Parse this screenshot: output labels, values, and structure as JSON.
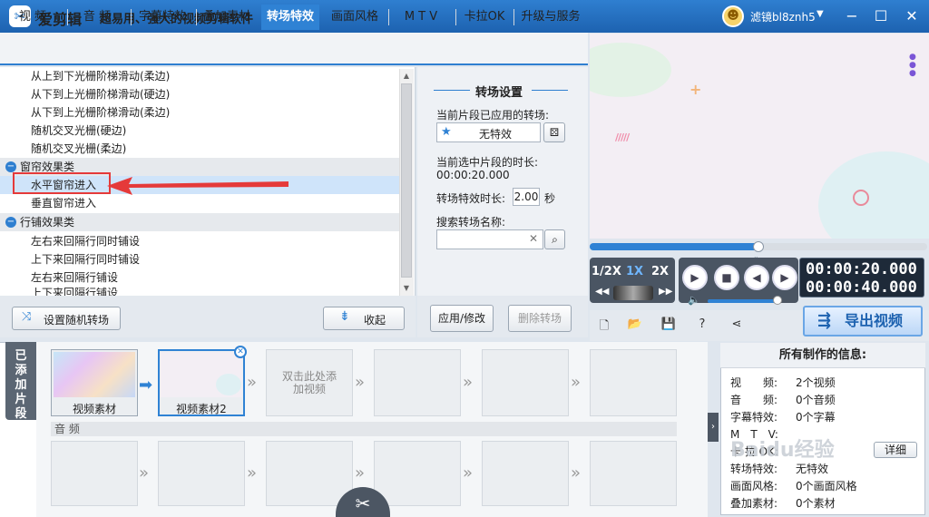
{
  "app": {
    "name": "爱剪辑",
    "slogan": "超易用、强大的视频剪辑软件",
    "username": "滤镜bl8znh5"
  },
  "tabs": [
    {
      "label": "视 频"
    },
    {
      "label": "音 频"
    },
    {
      "label": "字幕特效"
    },
    {
      "label": "叠加素材"
    },
    {
      "label": "转场特效",
      "active": true
    },
    {
      "label": "画面风格"
    },
    {
      "label": "M T V"
    },
    {
      "label": "卡拉OK"
    },
    {
      "label": "升级与服务"
    }
  ],
  "effects": {
    "items_top": [
      "从上到下光栅阶梯滑动(柔边)",
      "从下到上光栅阶梯滑动(硬边)",
      "从下到上光栅阶梯滑动(柔边)",
      "随机交叉光栅(硬边)",
      "随机交叉光栅(柔边)"
    ],
    "cat1": "窗帘效果类",
    "cat1_items": [
      "水平窗帘进入",
      "垂直窗帘进入"
    ],
    "cat2": "行铺效果类",
    "cat2_items": [
      "左右来回隔行同时铺设",
      "上下来回隔行同时铺设",
      "左右来回隔行铺设",
      "上下来回隔行铺设"
    ],
    "selected": "水平窗帘进入"
  },
  "settings": {
    "title": "转场设置",
    "applied_label": "当前片段已应用的转场:",
    "applied_value": "无特效",
    "duration_label": "当前选中片段的时长:",
    "duration_value": "00:00:20.000",
    "effect_duration_label": "转场特效时长:",
    "effect_duration_value": "2.00",
    "effect_duration_unit": "秒",
    "search_label": "搜索转场名称:",
    "search_placeholder": "",
    "apply_btn": "应用/修改",
    "delete_btn": "删除转场"
  },
  "left_buttons": {
    "random": "设置随机转场",
    "collapse": "收起"
  },
  "player": {
    "progress": 0.5,
    "speeds": [
      "1/2X",
      "1X",
      "2X"
    ],
    "active_speed": "1X",
    "time_current": "00:00:20.000",
    "time_total": "00:00:40.000",
    "export": "导出视频"
  },
  "clips": {
    "sidebar_label": "已添加片段",
    "items": [
      "视频素材",
      "视频素材2"
    ],
    "empty_hint": "双击此处添加视频",
    "audio_label": "音 频"
  },
  "info": {
    "title": "所有制作的信息:",
    "rows": [
      {
        "k": "视　　频:",
        "v": "2个视频"
      },
      {
        "k": "音　　频:",
        "v": "0个音频"
      },
      {
        "k": "字幕特效:",
        "v": "0个字幕"
      },
      {
        "k": "M　T　V:",
        "v": ""
      },
      {
        "k": "卡 拉 OK:",
        "v": ""
      },
      {
        "k": "转场特效:",
        "v": "无特效"
      },
      {
        "k": "画面风格:",
        "v": "0个画面风格"
      },
      {
        "k": "叠加素材:",
        "v": "0个素材"
      }
    ],
    "detail_btn": "详细",
    "watermark": "Baidu经验"
  },
  "colors": {
    "accent": "#2f82d4",
    "highlight": "#e53a3a"
  }
}
